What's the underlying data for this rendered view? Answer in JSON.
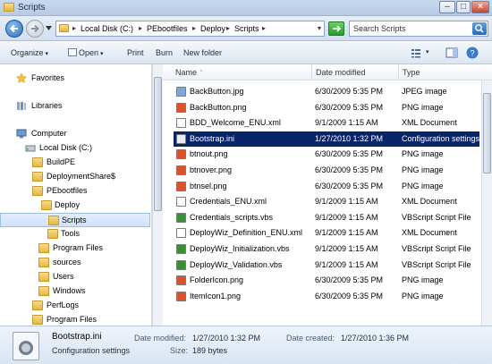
{
  "window": {
    "title": "Scripts"
  },
  "address": {
    "crumbs": [
      "Local Disk (C:)",
      "PEbootfiles",
      "Deploy",
      "Scripts"
    ],
    "search_placeholder": "Search Scripts"
  },
  "toolbar": {
    "organize": "Organize",
    "open": "Open",
    "print": "Print",
    "burn": "Burn",
    "new_folder": "New folder"
  },
  "nav": {
    "favorites": "Favorites",
    "libraries": "Libraries",
    "computer": "Computer",
    "local_disk": "Local Disk (C:)",
    "folders": [
      "BuildPE",
      "DeploymentShare$",
      "PEbootfiles",
      "Deploy",
      "Scripts",
      "Tools",
      "Program Files",
      "sources",
      "Users",
      "Windows",
      "PerfLogs",
      "Program Files"
    ]
  },
  "columns": {
    "name": "Name",
    "date": "Date modified",
    "type": "Type"
  },
  "files": [
    {
      "name": "BackButton.jpg",
      "date": "6/30/2009 5:35 PM",
      "type": "JPEG image",
      "icon": "image-icon"
    },
    {
      "name": "BackButton.png",
      "date": "6/30/2009 5:35 PM",
      "type": "PNG image",
      "icon": "png-icon"
    },
    {
      "name": "BDD_Welcome_ENU.xml",
      "date": "9/1/2009 1:15 AM",
      "type": "XML Document",
      "icon": "xml-icon"
    },
    {
      "name": "Bootstrap.ini",
      "date": "1/27/2010 1:32 PM",
      "type": "Configuration settings",
      "icon": "config-icon",
      "selected": true
    },
    {
      "name": "btnout.png",
      "date": "6/30/2009 5:35 PM",
      "type": "PNG image",
      "icon": "png-icon"
    },
    {
      "name": "btnover.png",
      "date": "6/30/2009 5:35 PM",
      "type": "PNG image",
      "icon": "png-icon"
    },
    {
      "name": "btnsel.png",
      "date": "6/30/2009 5:35 PM",
      "type": "PNG image",
      "icon": "png-icon"
    },
    {
      "name": "Credentials_ENU.xml",
      "date": "9/1/2009 1:15 AM",
      "type": "XML Document",
      "icon": "xml-icon"
    },
    {
      "name": "Credentials_scripts.vbs",
      "date": "9/1/2009 1:15 AM",
      "type": "VBScript Script File",
      "icon": "vbs-icon"
    },
    {
      "name": "DeployWiz_Definition_ENU.xml",
      "date": "9/1/2009 1:15 AM",
      "type": "XML Document",
      "icon": "xml-icon"
    },
    {
      "name": "DeployWiz_Initialization.vbs",
      "date": "9/1/2009 1:15 AM",
      "type": "VBScript Script File",
      "icon": "vbs-icon"
    },
    {
      "name": "DeployWiz_Validation.vbs",
      "date": "9/1/2009 1:15 AM",
      "type": "VBScript Script File",
      "icon": "vbs-icon"
    },
    {
      "name": "FolderIcon.png",
      "date": "6/30/2009 5:35 PM",
      "type": "PNG image",
      "icon": "png-icon"
    },
    {
      "name": "ItemIcon1.png",
      "date": "6/30/2009 5:35 PM",
      "type": "PNG image",
      "icon": "png-icon"
    }
  ],
  "details": {
    "name": "Bootstrap.ini",
    "type": "Configuration settings",
    "modified_label": "Date modified:",
    "modified_value": "1/27/2010 1:32 PM",
    "size_label": "Size:",
    "size_value": "189 bytes",
    "created_label": "Date created:",
    "created_value": "1/27/2010 1:36 PM"
  },
  "colors": {
    "selection": "#0a246a",
    "png_icon": "#d9532c",
    "vbs_icon": "#3b8e3b",
    "xml_icon": "#ffffff"
  }
}
